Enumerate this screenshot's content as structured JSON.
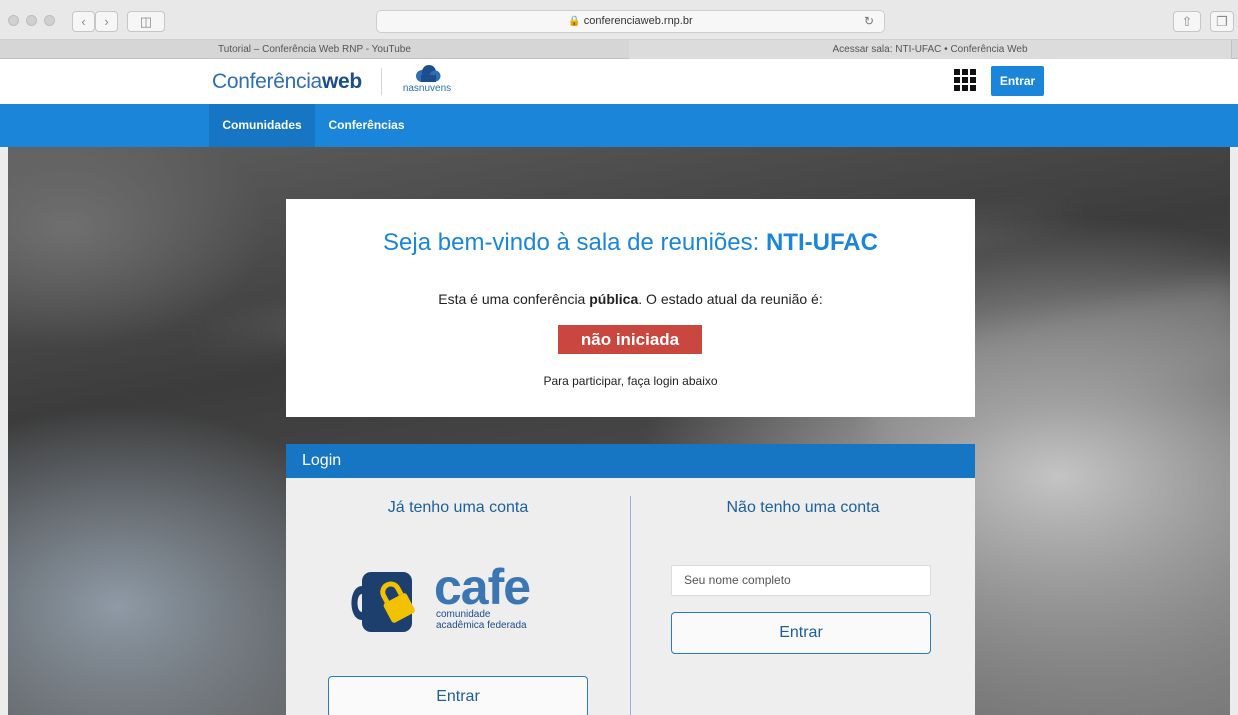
{
  "browser": {
    "url": "conferenciaweb.rnp.br",
    "tabs": [
      {
        "title": "Tutorial – Conferência Web RNP - YouTube",
        "active": false
      },
      {
        "title": "Acessar sala: NTI-UFAC • Conferência Web",
        "active": true
      }
    ]
  },
  "header": {
    "logo_regular": "Conferência",
    "logo_bold": "web",
    "partner_logo_text": "nasnuvens",
    "login_button": "Entrar"
  },
  "nav": {
    "items": [
      {
        "label": "Comunidades",
        "active": true
      },
      {
        "label": "Conferências",
        "active": false
      }
    ]
  },
  "welcome": {
    "title_prefix": "Seja bem-vindo à sala de reuniões: ",
    "room_name": "NTI-UFAC",
    "desc_prefix": "Esta é uma conferência ",
    "desc_bold": "pública",
    "desc_suffix": ". O estado atual da reunião é:",
    "status": "não iniciada",
    "hint": "Para participar, faça login abaixo"
  },
  "login": {
    "title": "Login",
    "left": {
      "heading": "Já tenho uma conta",
      "cafe_word": "cafe",
      "cafe_sub_line1": "comunidade",
      "cafe_sub_line2": "acadêmica federada",
      "button": "Entrar"
    },
    "right": {
      "heading": "Não tenho uma conta",
      "name_placeholder": "Seu nome completo",
      "button": "Entrar"
    }
  },
  "colors": {
    "brand_blue": "#1b86d9",
    "nav_active": "#1676c4",
    "status_red": "#c9473e",
    "panel_bg": "#eeeeee"
  }
}
